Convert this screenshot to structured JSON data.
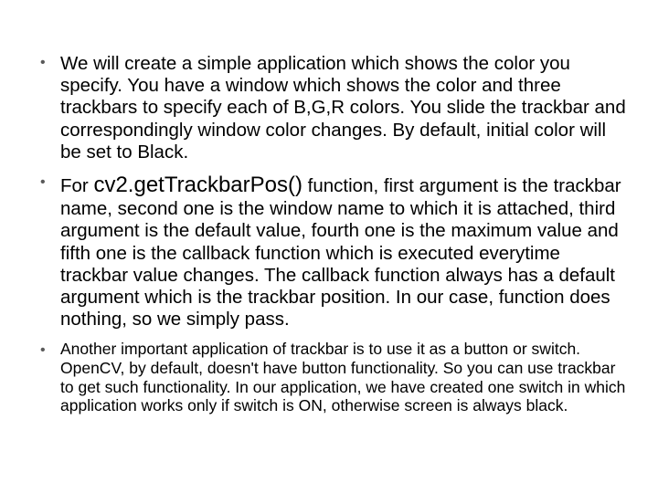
{
  "bullets": {
    "b1": "We will create a simple application which shows the color you specify. You have a window which shows the color and three trackbars to specify each of B,G,R colors. You slide the trackbar and correspondingly window color changes. By default, initial color will be set to Black.",
    "b2_pre": "For ",
    "b2_code": "cv2.getTrackbarPos()",
    "b2_post": " function, first argument is the trackbar name, second one is the window name to which it is attached, third argument is the default value, fourth one is the maximum value and fifth one is the callback function which is executed everytime trackbar value changes. The callback function always has a default argument which is the trackbar position. In our case, function does nothing, so we simply pass.",
    "b3": "Another important application of trackbar is to use it as a button or switch. OpenCV, by default, doesn't have button functionality. So you can use trackbar to get such functionality. In our application, we have created one switch in which application works only if switch is ON, otherwise screen is always black."
  }
}
